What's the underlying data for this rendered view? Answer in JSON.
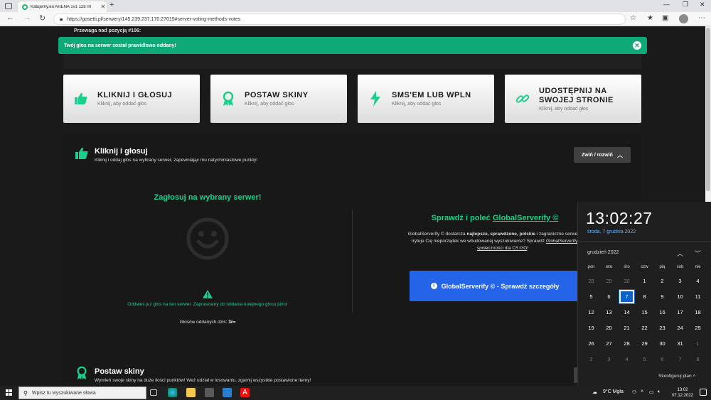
{
  "browser": {
    "tab_title": "Katujemy.eu ARENA 1v1 128TR",
    "url": "https://gosetti.pl/serwery/145.239.237.170:27015#server-voting-methods-votes"
  },
  "page": {
    "prewaga": "Przewaga nad pozycją #106:",
    "alert": "Twój głos na serwer został prawidłowo oddany!",
    "cards": [
      {
        "title": "KLIKNIJ I GŁOSUJ",
        "sub": "Kliknij, aby oddać głos",
        "icon": "thumbs-up-icon"
      },
      {
        "title": "POSTAW SKINY",
        "sub": "Kliknij, aby oddać głos",
        "icon": "award-icon"
      },
      {
        "title": "SMS'EM LUB WPLN",
        "sub": "Kliknij, aby oddać głos",
        "icon": "bolt-icon"
      },
      {
        "title_line1": "UDOSTĘPNIJ NA",
        "title_line2": "SWOJEJ STRONIE",
        "sub": "Kliknij, aby oddać głos",
        "icon": "link-icon"
      }
    ],
    "section1": {
      "title": "Kliknij i głosuj",
      "subtitle": "Kliknij i oddaj głos na wybrany serwer, zapewniając mu natychmiastowe punkty!",
      "toggle": "Zwiń / rozwiń",
      "vote_heading": "Zagłosuj na wybrany serwer!",
      "voted_msg": "Oddałeś już głos na ten serwer. Zapraszamy do oddania kolejnego głosu jutro!",
      "votes_today_label": "Głosów oddanych dziś:",
      "votes_today_value": "3/∞",
      "gs_heading_prefix": "Sprawdź i poleć",
      "gs_heading_link": "GlobalServerify ©",
      "gs_line1_a": "GlobalServerify © dostarcza",
      "gs_line1_b": "najlepsze, sprawdzone, polskie",
      "gs_line1_c": "i zagraniczne serwery bezpoś",
      "gs_line2_a": "Irytuje Cię nieporządek we wbudowanej wyszukiwarce? Sprawdź",
      "gs_line2_link": "GlobalServerify © - dos",
      "gs_line3_link": "społeczności dla CS:GO",
      "gs_line3_end": "!",
      "gs_button": "GlobalServerify © - Sprawdź szczegóły"
    },
    "section2": {
      "title": "Postaw skiny",
      "subtitle": "Wymień swoje skiny na duże ilości punktów! Weź udział w losowaniu, zgarnij wszystkie postawione itemy!"
    }
  },
  "calendar": {
    "time": "13:02:27",
    "date": "środa, 7 grudnia 2022",
    "month": "grudzień 2022",
    "weekdays": [
      "pon",
      "wto",
      "śro",
      "czw",
      "pią",
      "sob",
      "nie"
    ],
    "weeks": [
      [
        "28",
        "29",
        "30",
        "1",
        "2",
        "3",
        "4"
      ],
      [
        "5",
        "6",
        "7",
        "8",
        "9",
        "10",
        "11"
      ],
      [
        "12",
        "13",
        "14",
        "15",
        "16",
        "17",
        "18"
      ],
      [
        "19",
        "20",
        "21",
        "22",
        "23",
        "24",
        "25"
      ],
      [
        "26",
        "27",
        "28",
        "29",
        "30",
        "31",
        "1"
      ],
      [
        "2",
        "3",
        "4",
        "5",
        "6",
        "7",
        "8"
      ]
    ],
    "today": "7",
    "configure": "Skonfiguruj plan"
  },
  "taskbar": {
    "search_placeholder": "Wpisz tu wyszukiwane słowa",
    "weather": "9°C Mgła",
    "time": "13:02",
    "date": "07.12.2022"
  },
  "colors": {
    "accent": "#1ccf8a",
    "alert": "#0fa878",
    "button_blue": "#2563e8",
    "today": "#0a63c9"
  }
}
